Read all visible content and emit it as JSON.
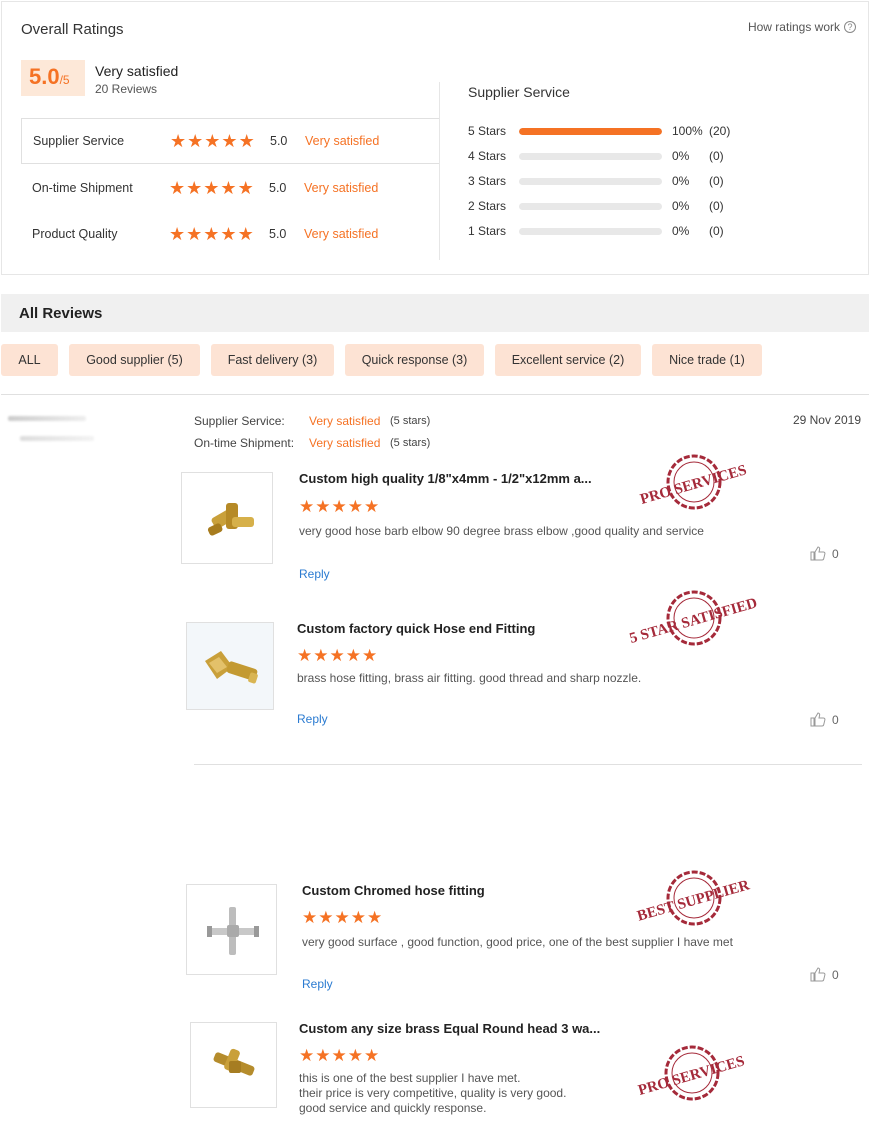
{
  "overall": {
    "title": "Overall Ratings",
    "how_link": "How ratings work",
    "score": "5.0",
    "score_max": "/5",
    "satisfaction": "Very satisfied",
    "reviews_count": "20 Reviews",
    "categories": [
      {
        "name": "Supplier Service",
        "score": "5.0",
        "label": "Very satisfied",
        "stars": 5
      },
      {
        "name": "On-time Shipment",
        "score": "5.0",
        "label": "Very satisfied",
        "stars": 5
      },
      {
        "name": "Product Quality",
        "score": "5.0",
        "label": "Very satisfied",
        "stars": 5
      }
    ]
  },
  "distribution": {
    "title": "Supplier Service",
    "rows": [
      {
        "label": "5  Stars",
        "fraction": 1.0,
        "pct": "100%",
        "count": "(20)"
      },
      {
        "label": "4  Stars",
        "fraction": 0,
        "pct": "0%",
        "count": "(0)"
      },
      {
        "label": "3  Stars",
        "fraction": 0,
        "pct": "0%",
        "count": "(0)"
      },
      {
        "label": "2  Stars",
        "fraction": 0,
        "pct": "0%",
        "count": "(0)"
      },
      {
        "label": "1  Stars",
        "fraction": 0,
        "pct": "0%",
        "count": "(0)"
      }
    ]
  },
  "all_reviews": {
    "title": "All Reviews",
    "tags": [
      "ALL",
      "Good supplier (5)",
      "Fast delivery (3)",
      "Quick response (3)",
      "Excellent service (2)",
      "Nice trade (1)"
    ]
  },
  "review": {
    "date": "29 Nov 2019",
    "supplier_service_label": "Supplier Service:",
    "supplier_service_value": "Very satisfied",
    "supplier_service_stars": "(5 stars)",
    "shipment_label": "On-time Shipment:",
    "shipment_value": "Very satisfied",
    "shipment_stars": "(5 stars)"
  },
  "products": [
    {
      "title": "Custom high quality 1/8\"x4mm - 1/2\"x12mm a...",
      "text": "very good hose barb elbow 90 degree brass elbow ,good quality and service",
      "reply": "Reply",
      "likes": "0",
      "stamp_line1": "PRO SERVICES",
      "stamp_line2": ""
    },
    {
      "title": "Custom factory quick Hose end Fitting",
      "text": "brass hose fitting, brass air fitting. good thread and sharp nozzle.",
      "reply": "Reply",
      "likes": "0",
      "stamp_line1": "5 STAR SATISFIED",
      "stamp_line2": ""
    },
    {
      "title": "Custom Chromed hose fitting",
      "text": "very good surface , good function, good price, one of the best supplier I have met",
      "reply": "Reply",
      "likes": "0",
      "stamp_line1": "BEST SUPPLIER",
      "stamp_line2": ""
    },
    {
      "title": "Custom any size brass Equal Round head 3 wa...",
      "text_lines": [
        "this is one of the best supplier I have met.",
        "their price is very competitive, quality is very good.",
        "good service and quickly response."
      ],
      "stamp_line1": "PRO SERVICES",
      "stamp_line2": ""
    }
  ],
  "colors": {
    "accent": "#f57224",
    "tag_bg": "#fde3d4",
    "stamp": "#a52a3a",
    "link": "#2b7bd1"
  }
}
